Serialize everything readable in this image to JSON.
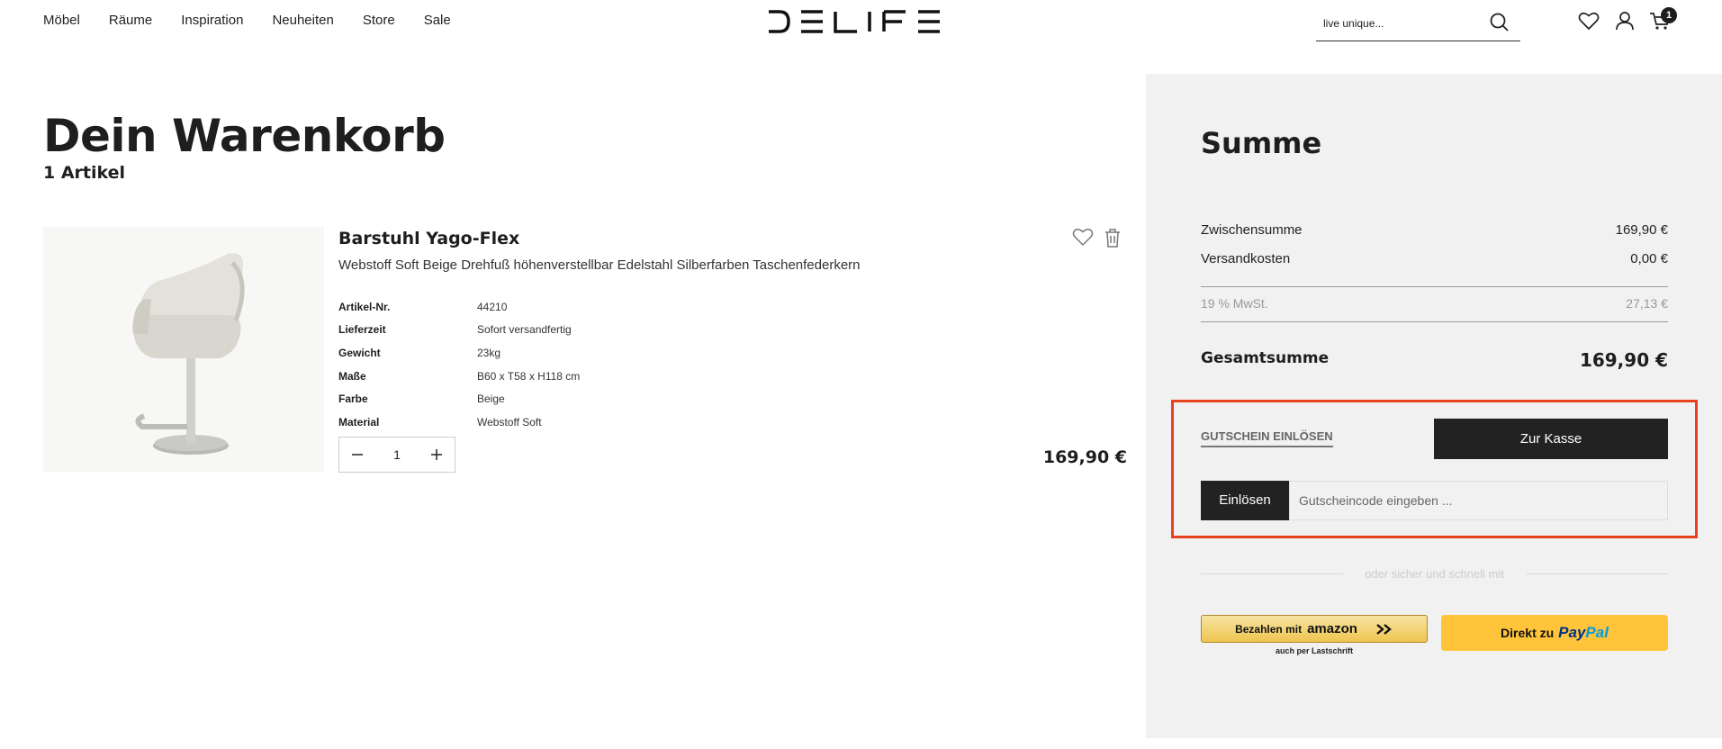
{
  "header": {
    "nav": [
      "Möbel",
      "Räume",
      "Inspiration",
      "Neuheiten",
      "Store",
      "Sale"
    ],
    "logo_text": "DELIFE",
    "search_placeholder": "live unique...",
    "cart_count": "1"
  },
  "cart": {
    "title": "Dein Warenkorb",
    "item_count": "1 Artikel"
  },
  "product": {
    "name": "Barstuhl Yago-Flex",
    "description": "Webstoff Soft Beige Drehfuß höhenverstellbar Edelstahl Silberfarben Taschenfederkern",
    "specs": [
      {
        "key": "Artikel-Nr.",
        "value": "44210"
      },
      {
        "key": "Lieferzeit",
        "value": "Sofort versandfertig"
      },
      {
        "key": "Gewicht",
        "value": "23kg"
      },
      {
        "key": "Maße",
        "value": "B60 x T58 x H118 cm"
      },
      {
        "key": "Farbe",
        "value": "Beige"
      },
      {
        "key": "Material",
        "value": "Webstoff Soft"
      }
    ],
    "quantity": "1",
    "price": "169,90 €"
  },
  "summary": {
    "title": "Summe",
    "subtotal_label": "Zwischensumme",
    "subtotal_value": "169,90 €",
    "shipping_label": "Versandkosten",
    "shipping_value": "0,00 €",
    "tax_label": "19 % MwSt.",
    "tax_value": "27,13 €",
    "total_label": "Gesamtsumme",
    "total_value": "169,90 €",
    "voucher_link": "GUTSCHEIN EINLÖSEN",
    "checkout_label": "Zur Kasse",
    "redeem_label": "Einlösen",
    "voucher_placeholder": "Gutscheincode eingeben ...",
    "or_text": "oder sicher und schnell mit",
    "amazon_label": "Bezahlen mit",
    "amazon_brand": "amazon",
    "amazon_sub": "auch per Lastschrift",
    "paypal_label": "Direkt zu",
    "paypal_brand_1": "Pay",
    "paypal_brand_2": "Pal"
  },
  "colors": {
    "accent_dark": "#222222",
    "panel_bg": "#f1f1f1",
    "highlight_border": "#e8411e",
    "paypal_yellow": "#ffc439"
  }
}
